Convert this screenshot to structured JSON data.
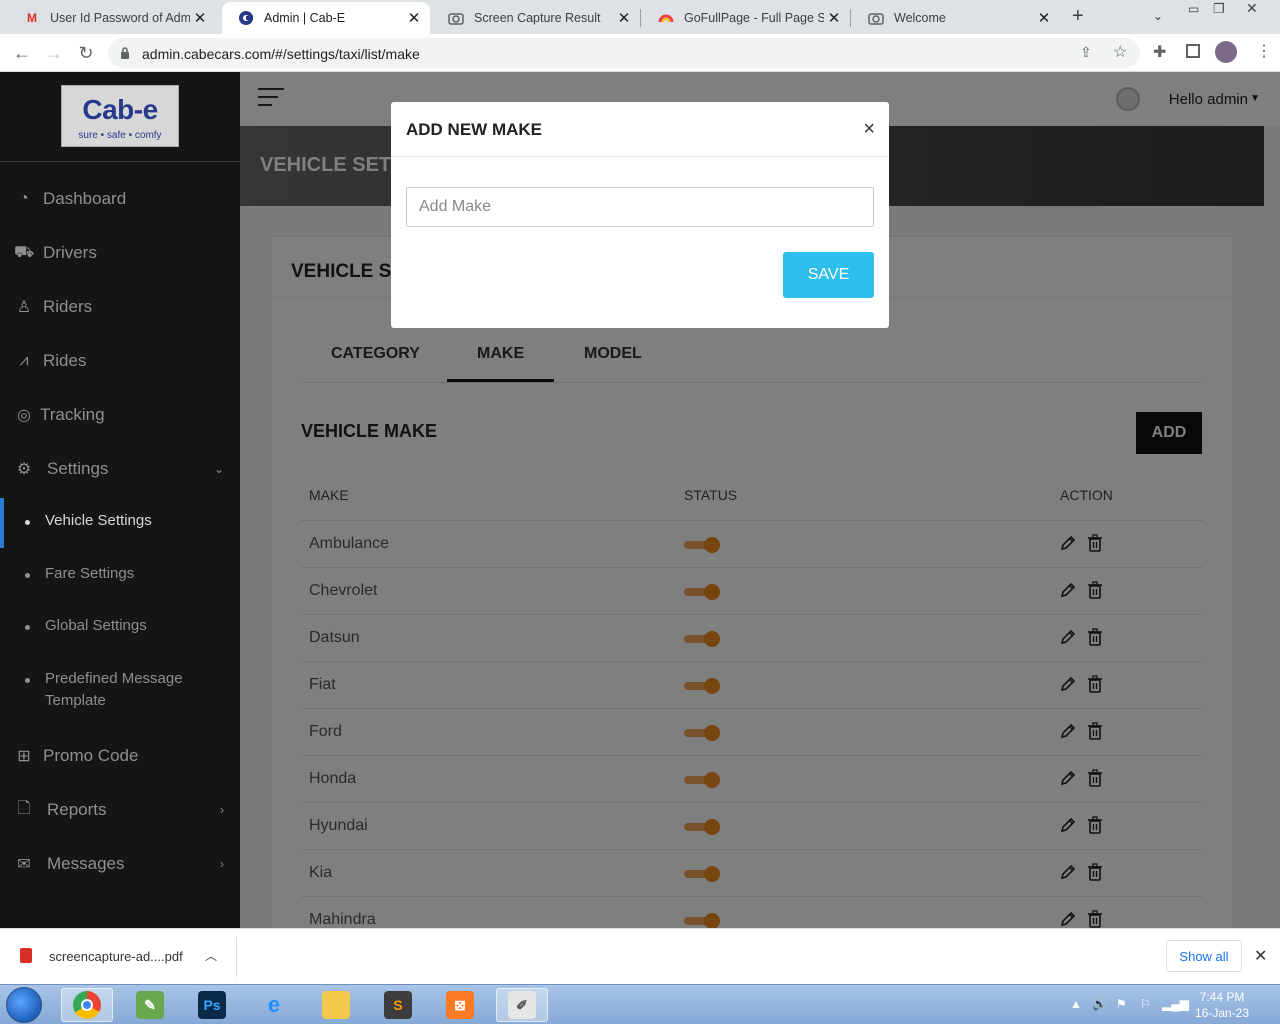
{
  "browser": {
    "tabs": [
      {
        "title": "User Id Password of Admin",
        "icon": "gmail-icon",
        "active": false
      },
      {
        "title": "Admin | Cab-E",
        "icon": "cabe-favicon",
        "active": true
      },
      {
        "title": "Screen Capture Result",
        "icon": "camera-icon",
        "active": false
      },
      {
        "title": "GoFullPage - Full Page Scre",
        "icon": "gofullpage-icon",
        "active": false
      },
      {
        "title": "Welcome",
        "icon": "camera-icon",
        "active": false
      }
    ],
    "url": "admin.cabecars.com/#/settings/taxi/list/make"
  },
  "logo": {
    "text": "Cab-e",
    "tagline": "sure • safe • comfy"
  },
  "sidebar": {
    "items": [
      {
        "label": "Dashboard",
        "icon": "clock-icon"
      },
      {
        "label": "Drivers",
        "icon": "car-icon"
      },
      {
        "label": "Riders",
        "icon": "user-icon"
      },
      {
        "label": "Rides",
        "icon": "road-icon"
      },
      {
        "label": "Tracking",
        "icon": "target-icon"
      },
      {
        "label": "Settings",
        "icon": "gear-icon"
      },
      {
        "label": "Promo Code",
        "icon": "gift-icon"
      },
      {
        "label": "Reports",
        "icon": "file-icon"
      },
      {
        "label": "Messages",
        "icon": "envelope-icon"
      }
    ],
    "sub_items": [
      {
        "label": "Vehicle Settings",
        "active": true
      },
      {
        "label": "Fare Settings",
        "active": false
      },
      {
        "label": "Global Settings",
        "active": false
      },
      {
        "label": "Predefined Message Template",
        "active": false
      }
    ]
  },
  "header": {
    "greeting": "Hello admin"
  },
  "banner": {
    "title": "VEHICLE SETT"
  },
  "card": {
    "title": "VEHICLE S"
  },
  "tabs": [
    "CATEGORY",
    "MAKE",
    "MODEL"
  ],
  "active_tab": "MAKE",
  "section": {
    "title": "VEHICLE MAKE",
    "add_label": "ADD"
  },
  "table": {
    "headers": [
      "MAKE",
      "STATUS",
      "ACTION"
    ],
    "rows": [
      {
        "make": "Ambulance",
        "status": true
      },
      {
        "make": "Chevrolet",
        "status": true
      },
      {
        "make": "Datsun",
        "status": true
      },
      {
        "make": "Fiat",
        "status": true
      },
      {
        "make": "Ford",
        "status": true
      },
      {
        "make": "Honda",
        "status": true
      },
      {
        "make": "Hyundai",
        "status": true
      },
      {
        "make": "Kia",
        "status": true
      },
      {
        "make": "Mahindra",
        "status": true
      }
    ]
  },
  "modal": {
    "title": "ADD NEW MAKE",
    "close": "×",
    "input_placeholder": "Add Make",
    "input_value": "",
    "save_label": "SAVE"
  },
  "downloads": {
    "file": "screencapture-ad....pdf",
    "show_all": "Show all"
  },
  "taskbar": {
    "time": "7:44 PM",
    "date": "16-Jan-23"
  },
  "colors": {
    "sidebar_bg": "#151515",
    "active_indicator": "#2a7bd6",
    "toggle_on": "#ef8a1f",
    "save_button": "#2ebfec",
    "add_button": "#111111"
  }
}
